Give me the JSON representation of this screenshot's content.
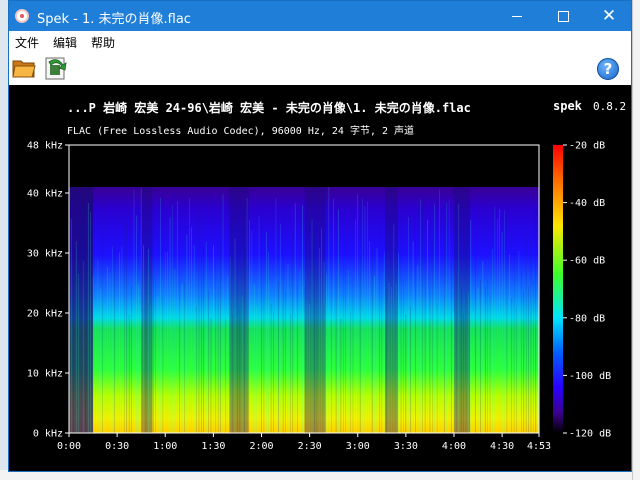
{
  "window": {
    "title": "Spek - 1. 未完の肖像.flac",
    "close_glyph": "✕"
  },
  "menu": {
    "items": [
      "文件",
      "编辑",
      "帮助"
    ]
  },
  "toolbar": {
    "help_glyph": "?"
  },
  "spectrogram": {
    "title": "...P 岩崎  宏美 24-96\\岩崎  宏美 - 未完の肖像\\1. 未完の肖像.flac",
    "app_label": "spek",
    "app_version": "0.8.2",
    "description": "FLAC (Free Lossless Audio Codec), 96000 Hz, 24 字节, 2 声道"
  },
  "chart_data": {
    "type": "heatmap",
    "xlabel": "",
    "ylabel": "",
    "x_ticks": [
      "0:00",
      "0:30",
      "1:00",
      "1:30",
      "2:00",
      "2:30",
      "3:00",
      "3:30",
      "4:00",
      "4:30",
      "4:53"
    ],
    "x_range_seconds": [
      0,
      293
    ],
    "y_ticks": [
      "0 kHz",
      "10 kHz",
      "20 kHz",
      "30 kHz",
      "40 kHz",
      "48 kHz"
    ],
    "y_range_khz": [
      0,
      48
    ],
    "colorbar_ticks": [
      "-20 dB",
      "-40 dB",
      "-60 dB",
      "-80 dB",
      "-100 dB",
      "-120 dB"
    ],
    "colorbar_range_db": [
      -120,
      -20
    ],
    "content_cutoff_khz": 41,
    "quiet_sections_seconds": [
      [
        0,
        15
      ],
      [
        45,
        52
      ],
      [
        100,
        112
      ],
      [
        147,
        160
      ],
      [
        197,
        205
      ],
      [
        240,
        250
      ]
    ]
  }
}
